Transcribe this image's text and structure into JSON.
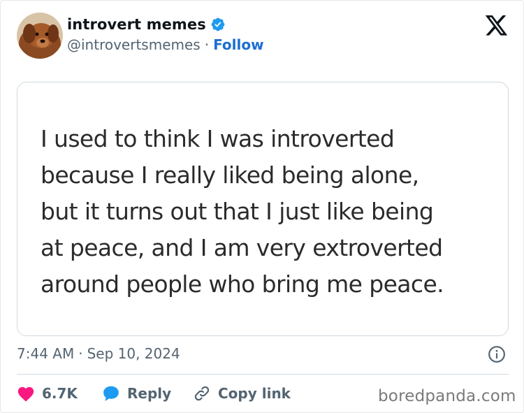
{
  "author": {
    "display_name": "introvert memes",
    "handle": "@introvertsmemes",
    "separator": "·",
    "follow_label": "Follow",
    "verified_color": "#1d9bf0",
    "avatar_icon": "dog-avatar"
  },
  "platform_icon": "x-logo-icon",
  "post": {
    "lines": [
      "I used to think I was introverted",
      "because I really liked being alone,",
      "but it turns out that I just like being",
      "at peace, and I am very extroverted",
      "around people who bring me peace."
    ]
  },
  "meta": {
    "time": "7:44 AM",
    "separator": "·",
    "date": "Sep 10, 2024"
  },
  "actions": {
    "like_count": "6.7K",
    "reply_label": "Reply",
    "copy_label": "Copy link",
    "like_color": "#f91880",
    "reply_color": "#1d9bf0"
  },
  "watermark": "boredpanda.com"
}
